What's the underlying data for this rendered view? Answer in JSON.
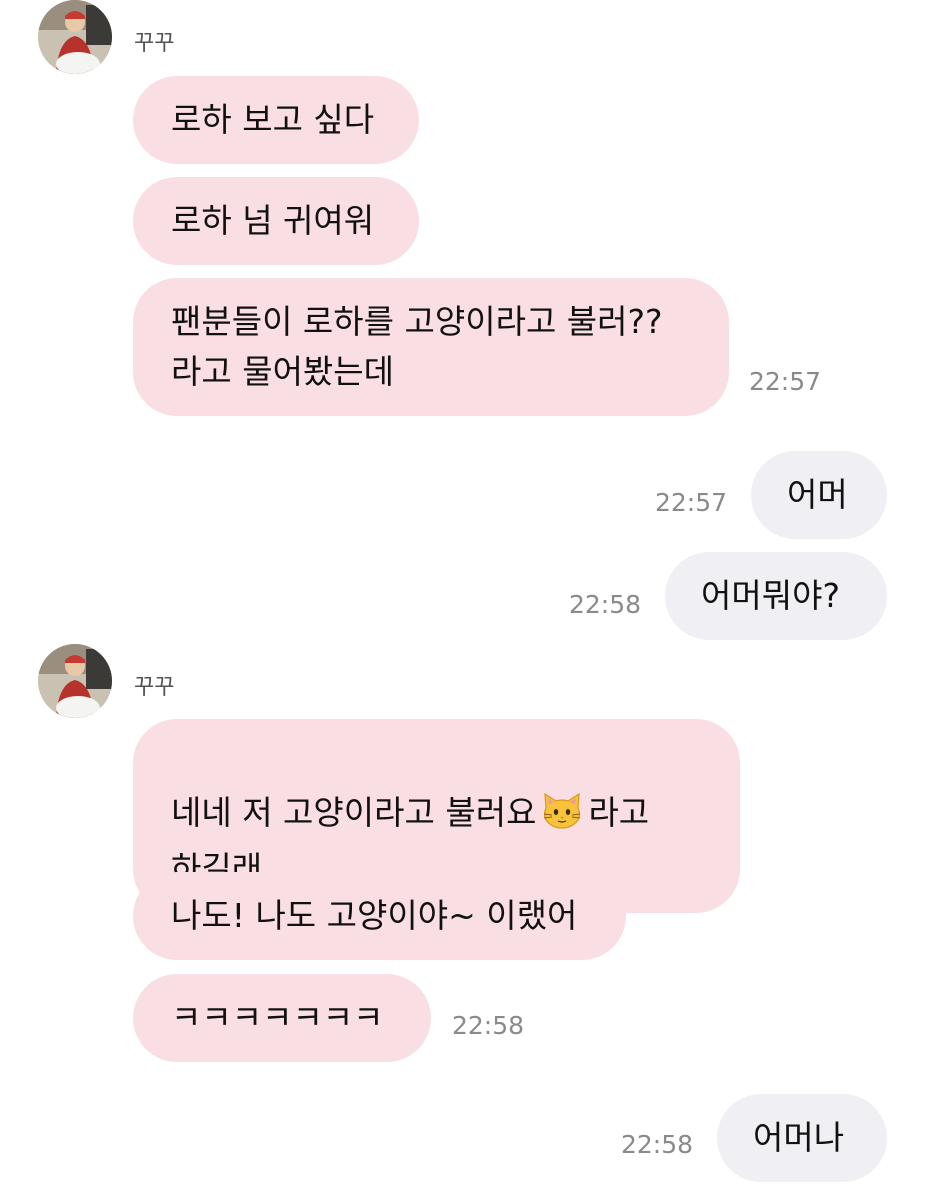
{
  "colors": {
    "incoming_bubble": "#f9dfe3",
    "outgoing_bubble": "#f0f0f4",
    "timestamp": "#8a8a8a",
    "background": "#ffffff"
  },
  "group1": {
    "sender": "꾸꾸",
    "messages": [
      "로하 보고 싶다",
      "로하 넘 귀여워",
      "팬분들이 로하를 고양이라고 불러??\n라고 물어봤는데"
    ],
    "time": "22:57"
  },
  "out1": {
    "text": "어머",
    "time": "22:57"
  },
  "out2": {
    "text": "어머뭐야?",
    "time": "22:58"
  },
  "group2": {
    "sender": "꾸꾸",
    "message1": {
      "before_emoji": "네네 저 고양이라고 불러요",
      "emoji": "cat-face-icon",
      "after_emoji": "라고\n하길래"
    },
    "message2": "나도! 나도 고양이야~ 이랬어",
    "message3": "ㅋㅋㅋㅋㅋㅋㅋ",
    "time": "22:58"
  },
  "out3": {
    "text": "어머나",
    "time": "22:58"
  }
}
